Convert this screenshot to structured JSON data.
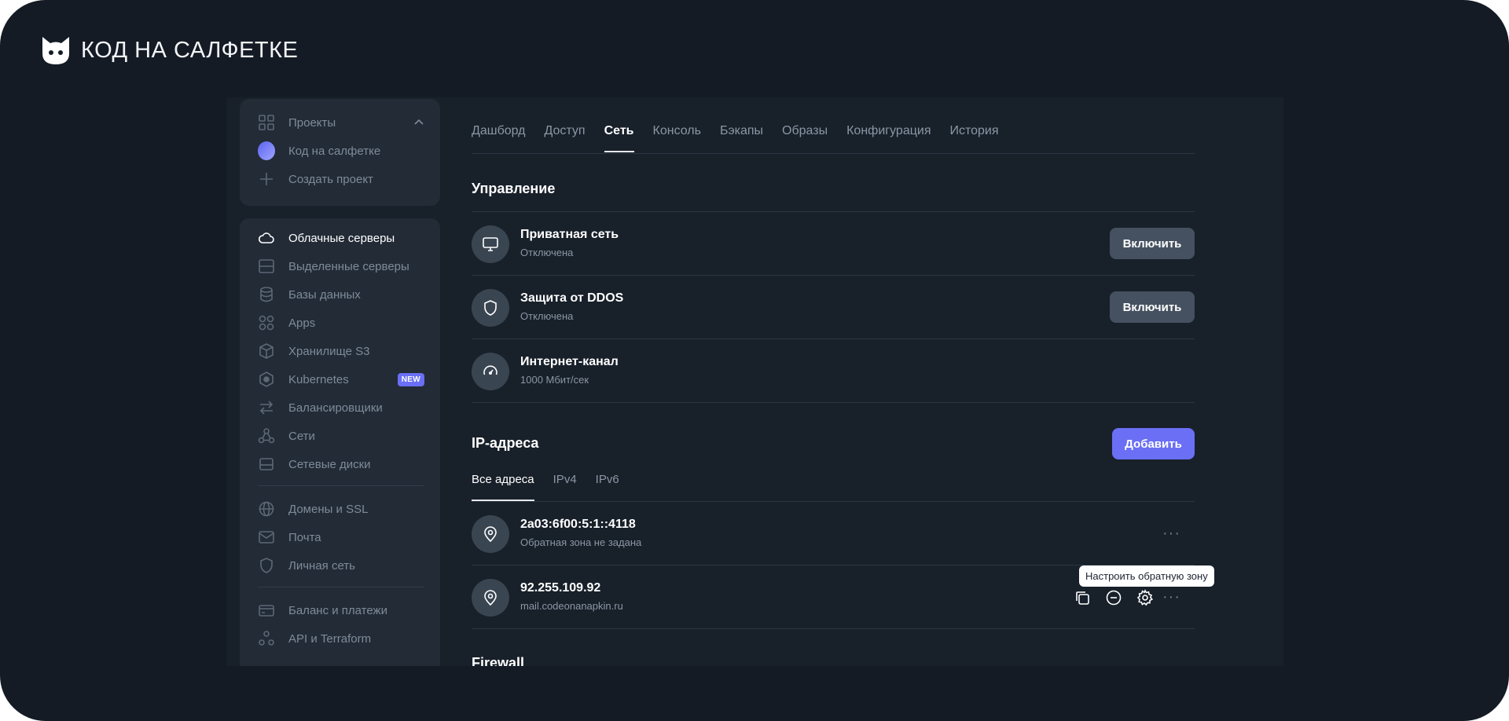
{
  "brand": {
    "name": "КОД НА САЛФЕТКЕ"
  },
  "sidebar": {
    "projects": [
      {
        "label": "Проекты",
        "icon": "grid-icon"
      },
      {
        "label": "Код на салфетке",
        "icon": "avatar"
      },
      {
        "label": "Создать проект",
        "icon": "plus-icon"
      }
    ],
    "items": [
      {
        "label": "Облачные серверы",
        "icon": "cloud-icon",
        "active": true
      },
      {
        "label": "Выделенные серверы",
        "icon": "server-icon"
      },
      {
        "label": "Базы данных",
        "icon": "database-icon"
      },
      {
        "label": "Apps",
        "icon": "apps-icon"
      },
      {
        "label": "Хранилище S3",
        "icon": "box-icon"
      },
      {
        "label": "Kubernetes",
        "icon": "kubernetes-icon",
        "badge": "NEW"
      },
      {
        "label": "Балансировщики",
        "icon": "arrows-icon"
      },
      {
        "label": "Сети",
        "icon": "network-icon"
      },
      {
        "label": "Сетевые диски",
        "icon": "disk-icon"
      },
      {
        "label": "Домены и SSL",
        "icon": "globe-icon"
      },
      {
        "label": "Почта",
        "icon": "mail-icon"
      },
      {
        "label": "Личная сеть",
        "icon": "shield-icon"
      },
      {
        "label": "Баланс и платежи",
        "icon": "card-icon"
      },
      {
        "label": "API и Terraform",
        "icon": "api-icon"
      }
    ]
  },
  "tabs": [
    "Дашборд",
    "Доступ",
    "Сеть",
    "Консоль",
    "Бэкапы",
    "Образы",
    "Конфигурация",
    "История"
  ],
  "active_tab": "Сеть",
  "management": {
    "title": "Управление",
    "rows": [
      {
        "title": "Приватная сеть",
        "subtitle": "Отключена",
        "button": "Включить",
        "icon": "monitor-icon"
      },
      {
        "title": "Защита от DDOS",
        "subtitle": "Отключена",
        "button": "Включить",
        "icon": "shield-icon"
      },
      {
        "title": "Интернет-канал",
        "subtitle": "1000 Мбит/сек",
        "icon": "speedometer-icon"
      }
    ]
  },
  "ip": {
    "title": "IP-адреса",
    "add_button": "Добавить",
    "subtabs": [
      "Все адреса",
      "IPv4",
      "IPv6"
    ],
    "rows": [
      {
        "address": "2a03:6f00:5:1::4118",
        "subtitle": "Обратная зона не задана"
      },
      {
        "address": "92.255.109.92",
        "subtitle": "mail.codeonanapkin.ru"
      }
    ],
    "tooltip": "Настроить обратную зону"
  },
  "next_section_title": "Firewall",
  "colors": {
    "background": "#151b25",
    "panel": "#18202a",
    "sidebar": "#222b36",
    "accent": "#6a6ff5"
  }
}
